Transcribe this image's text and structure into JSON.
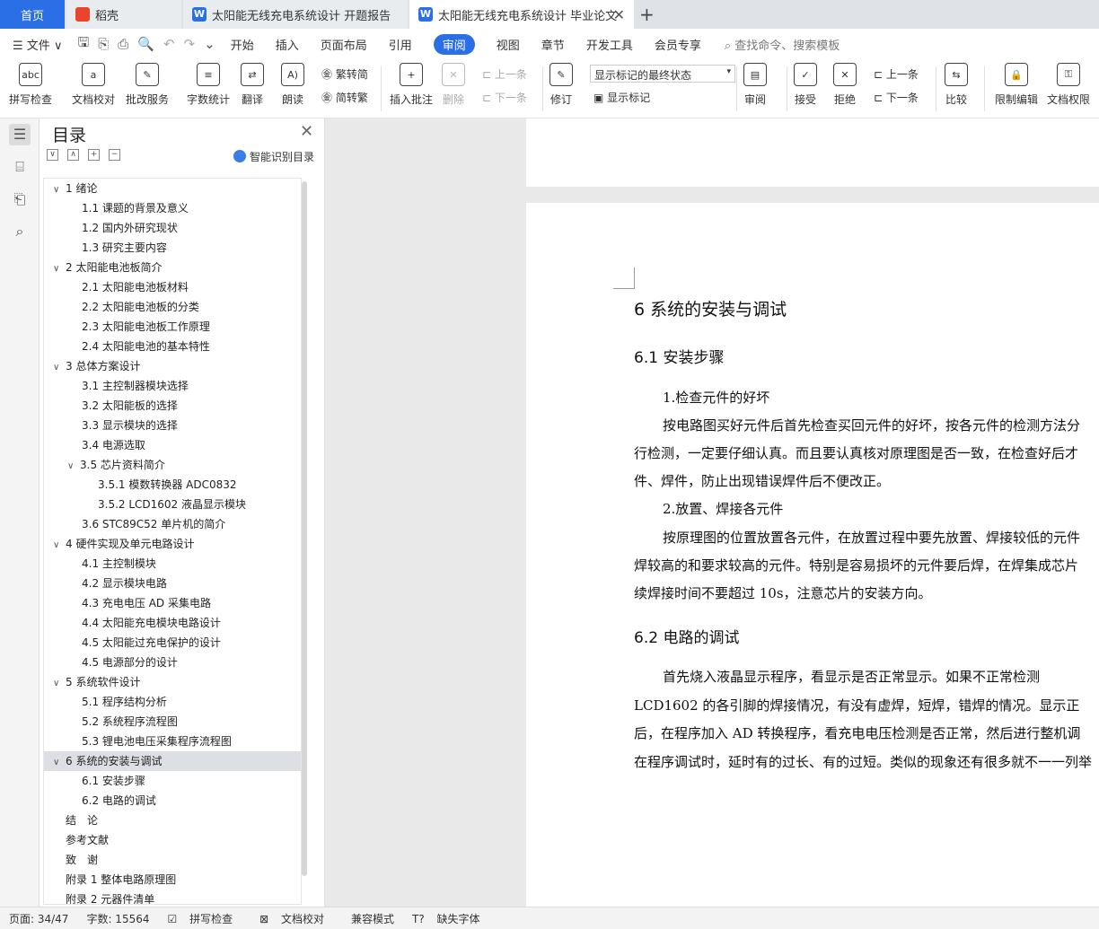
{
  "tabs": {
    "home": "首页",
    "daoke": "稻壳",
    "doc1": "太阳能无线充电系统设计 开题报告",
    "doc2": "太阳能无线充电系统设计 毕业论文",
    "new_tab": "+",
    "close": "✕"
  },
  "menu": {
    "file": "文件",
    "items": [
      "开始",
      "插入",
      "页面布局",
      "引用",
      "审阅",
      "视图",
      "章节",
      "开发工具",
      "会员专享"
    ],
    "active": "审阅",
    "search": "查找命令、搜索模板"
  },
  "ribbon": {
    "spell": "拼写检查",
    "proof": "文档校对",
    "review_service": "批改服务",
    "word_count": "字数统计",
    "translate": "翻译",
    "read": "朗读",
    "to_traditional": "繁转简",
    "to_simplified": "简转繁",
    "insert_comment": "插入批注",
    "delete": "删除",
    "prev": "上一条",
    "next": "下一条",
    "track": "修订",
    "show_markup_state": "显示标记的最终状态",
    "show_markup": "显示标记",
    "review": "审阅",
    "accept": "接受",
    "reject": "拒绝",
    "prev2": "上一条",
    "next2": "下一条",
    "compare": "比较",
    "restrict": "限制编辑",
    "doc_rights": "文档权限",
    "icon_spell": "abc"
  },
  "toc": {
    "title": "目录",
    "smart": "智能识别目录",
    "items": [
      {
        "label": "1  绪论",
        "level": 1,
        "arrow": "∨"
      },
      {
        "label": "1.1 课题的背景及意义",
        "level": 2
      },
      {
        "label": "1.2 国内外研究现状",
        "level": 2
      },
      {
        "label": "1.3 研究主要内容",
        "level": 2
      },
      {
        "label": "2  太阳能电池板简介",
        "level": 1,
        "arrow": "∨"
      },
      {
        "label": "2.1 太阳能电池板材料",
        "level": 2
      },
      {
        "label": "2.2 太阳能电池板的分类",
        "level": 2
      },
      {
        "label": "2.3 太阳能电池板工作原理",
        "level": 2
      },
      {
        "label": "2.4 太阳能电池的基本特性",
        "level": 2
      },
      {
        "label": "3  总体方案设计",
        "level": 1,
        "arrow": "∨"
      },
      {
        "label": "3.1 主控制器模块选择",
        "level": 2
      },
      {
        "label": "3.2 太阳能板的选择",
        "level": 2
      },
      {
        "label": "3.3 显示模块的选择",
        "level": 2
      },
      {
        "label": "3.4 电源选取",
        "level": 2
      },
      {
        "label": "3.5 芯片资料简介",
        "level": 2,
        "arrow": "∨"
      },
      {
        "label": "3.5.1 模数转换器 ADC0832",
        "level": 3
      },
      {
        "label": "3.5.2 LCD1602 液晶显示模块",
        "level": 3
      },
      {
        "label": "3.6 STC89C52 单片机的简介",
        "level": 2
      },
      {
        "label": "4  硬件实现及单元电路设计",
        "level": 1,
        "arrow": "∨"
      },
      {
        "label": "4.1 主控制模块",
        "level": 2
      },
      {
        "label": "4.2 显示模块电路",
        "level": 2
      },
      {
        "label": "4.3 充电电压 AD 采集电路",
        "level": 2
      },
      {
        "label": "4.4 太阳能充电模块电路设计",
        "level": 2
      },
      {
        "label": "4.5 太阳能过充电保护的设计",
        "level": 2
      },
      {
        "label": "4.5 电源部分的设计",
        "level": 2
      },
      {
        "label": "5  系统软件设计",
        "level": 1,
        "arrow": "∨"
      },
      {
        "label": "5.1 程序结构分析",
        "level": 2
      },
      {
        "label": "5.2 系统程序流程图",
        "level": 2
      },
      {
        "label": "5.3 锂电池电压采集程序流程图",
        "level": 2
      },
      {
        "label": "6  系统的安装与调试",
        "level": 1,
        "arrow": "∨",
        "selected": true
      },
      {
        "label": "6.1 安装步骤",
        "level": 2
      },
      {
        "label": "6.2 电路的调试",
        "level": 2
      },
      {
        "label": "结　论",
        "level": 1
      },
      {
        "label": "参考文献",
        "level": 1
      },
      {
        "label": "致　谢",
        "level": 1
      },
      {
        "label": "附录 1 整体电路原理图",
        "level": 1
      },
      {
        "label": "附录 2 元器件清单",
        "level": 1
      }
    ]
  },
  "doc": {
    "h1": "6  系统的安装与调试",
    "h2a": "6.1 安装步骤",
    "p1": "1.检查元件的好坏",
    "p2": "按电路图买好元件后首先检查买回元件的好坏，按各元件的检测方法分",
    "p3": "行检测，一定要仔细认真。而且要认真核对原理图是否一致，在检查好后才",
    "p4": "件、焊件，防止出现错误焊件后不便改正。",
    "p5": "2.放置、焊接各元件",
    "p6": "按原理图的位置放置各元件，在放置过程中要先放置、焊接较低的元件",
    "p7": "焊较高的和要求较高的元件。特别是容易损坏的元件要后焊，在焊集成芯片",
    "p8": "续焊接时间不要超过 10s，注意芯片的安装方向。",
    "h2b": "6.2 电路的调试",
    "p9": "首先烧入液晶显示程序，看显示是否正常显示。如果不正常检测",
    "p10": "LCD1602 的各引脚的焊接情况，有没有虚焊，短焊，错焊的情况。显示正",
    "p11": "后，在程序加入 AD 转换程序，看充电电压检测是否正常，然后进行整机调",
    "p12": "在程序调试时，延时有的过长、有的过短。类似的现象还有很多就不一一列举"
  },
  "status": {
    "page": "页面: 34/47",
    "words": "字数: 15564",
    "spell": "拼写检查",
    "proof": "文档校对",
    "compat": "兼容模式",
    "missing_font": "缺失字体"
  }
}
